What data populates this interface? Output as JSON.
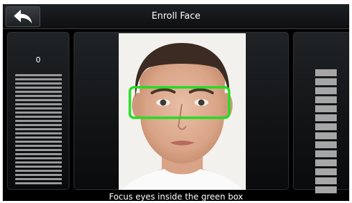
{
  "header": {
    "title": "Enroll Face",
    "back_icon": "back-arrow-icon"
  },
  "progress": {
    "count": "0",
    "left_bar_count": 27,
    "right_bar_count": 14
  },
  "camera": {
    "subject": "face-preview",
    "guide_box_color": "#22dd22"
  },
  "footer": {
    "instruction": "Focus eyes inside the green box"
  },
  "colors": {
    "background": "#000000",
    "bar": "#9a9a9a",
    "text": "#ffffff"
  }
}
